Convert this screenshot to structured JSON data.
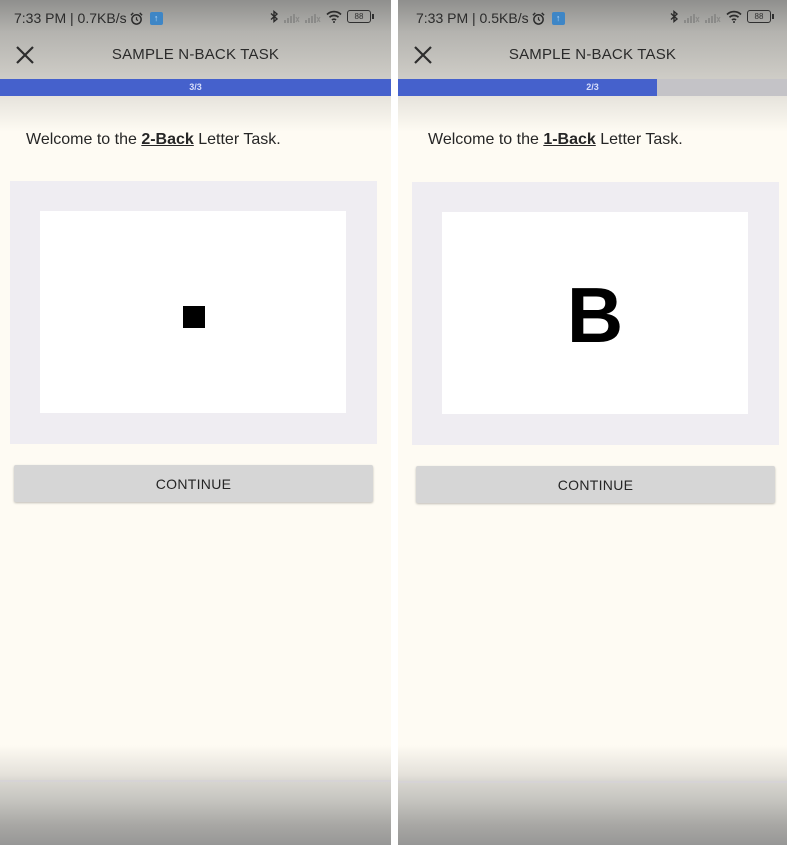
{
  "screens": [
    {
      "status": {
        "time_speed": "7:33 PM | 0.7KB/s",
        "icons": [
          "alarm-icon",
          "upload-notification-icon",
          "bluetooth-icon",
          "signal-icon",
          "signal-icon",
          "wifi-icon",
          "battery-icon"
        ],
        "battery": "88"
      },
      "appbar": {
        "title": "SAMPLE N-BACK TASK",
        "close_icon": "close-icon"
      },
      "progress": {
        "label": "3/3",
        "fraction": 1.0,
        "fill_color": "#4561cc"
      },
      "welcome": {
        "prefix": "Welcome to the ",
        "highlight": "2-Back",
        "suffix": " Letter Task."
      },
      "stimulus": {
        "type": "square",
        "text": ""
      },
      "continue_label": "CONTINUE"
    },
    {
      "status": {
        "time_speed": "7:33 PM | 0.5KB/s",
        "icons": [
          "alarm-icon",
          "upload-notification-icon",
          "bluetooth-icon",
          "signal-icon",
          "signal-icon",
          "wifi-icon",
          "battery-icon"
        ],
        "battery": "88"
      },
      "appbar": {
        "title": "SAMPLE N-BACK TASK",
        "close_icon": "close-icon"
      },
      "progress": {
        "label": "2/3",
        "fraction": 0.667,
        "fill_color": "#4561cc"
      },
      "welcome": {
        "prefix": "Welcome to the ",
        "highlight": "1-Back",
        "suffix": " Letter Task."
      },
      "stimulus": {
        "type": "letter",
        "text": "B"
      },
      "continue_label": "CONTINUE"
    }
  ]
}
